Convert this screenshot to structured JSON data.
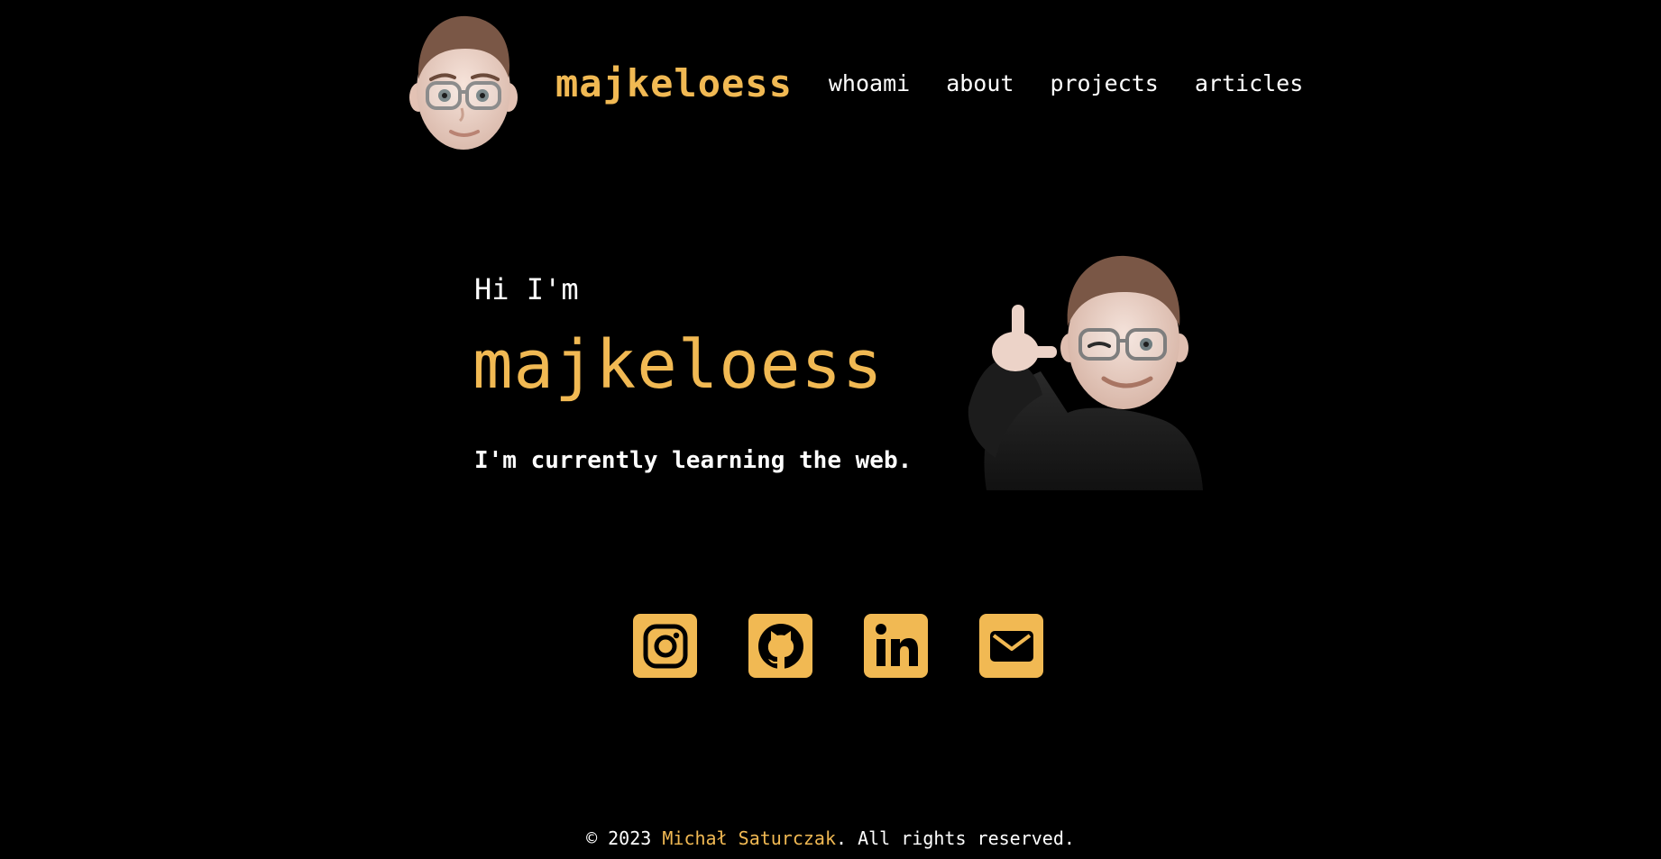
{
  "header": {
    "brand": "majkeloess",
    "nav": [
      {
        "label": "whoami"
      },
      {
        "label": "about"
      },
      {
        "label": "projects"
      },
      {
        "label": "articles"
      }
    ]
  },
  "hero": {
    "greeting": "Hi I'm",
    "name": "majkeloess",
    "tagline": "I'm currently learning the web."
  },
  "socials": [
    {
      "icon": "instagram-icon"
    },
    {
      "icon": "github-icon"
    },
    {
      "icon": "linkedin-icon"
    },
    {
      "icon": "mail-icon"
    }
  ],
  "footer": {
    "copyright": "© 2023",
    "author": "Michał Saturczak",
    "rights": ". All rights reserved."
  },
  "colors": {
    "background": "#000000",
    "accent": "#f1b953",
    "text": "#ffffff"
  }
}
